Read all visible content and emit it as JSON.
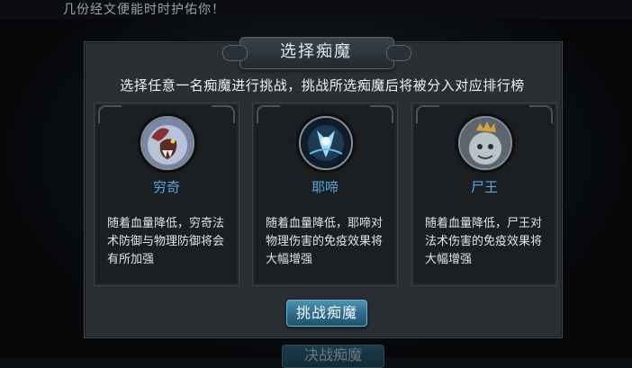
{
  "marquee_text": "几份经文便能时时护佑你！",
  "dialog": {
    "title": "选择痴魔",
    "subtitle": "选择任意一名痴魔进行挑战，挑战所选痴魔后将被分入对应排行榜",
    "bosses": [
      {
        "name": "穷奇",
        "description": "随着血量降低，穷奇法术防御与物理防御将会有所加强",
        "icon": "beast-icon"
      },
      {
        "name": "耶啼",
        "description": "随着血量降低，耶啼对物理伤害的免疫效果将大幅增强",
        "icon": "spirit-icon"
      },
      {
        "name": "尸王",
        "description": "随着血量降低，尸王对法术伤害的免疫效果将大幅增强",
        "icon": "crowned-zombie-icon"
      }
    ],
    "challenge_button": "挑战痴魔"
  },
  "background_button": "决战痴魔",
  "colors": {
    "boss_name": "#58a8e6",
    "button": "#2f6d8b",
    "panel": "#2b2f33"
  }
}
